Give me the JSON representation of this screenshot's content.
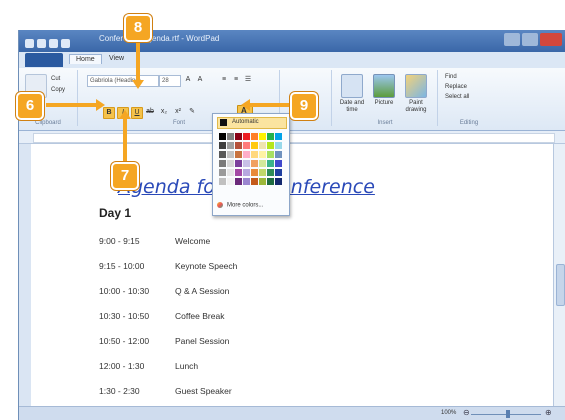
{
  "window": {
    "title": "Conference Agenda.rtf - WordPad"
  },
  "tabs": [
    {
      "label": "Home"
    },
    {
      "label": "View"
    }
  ],
  "ribbon": {
    "clipboard": {
      "cut": "Cut",
      "copy": "Copy",
      "label": "Clipboard"
    },
    "font": {
      "family": "Gabriola (Heading)",
      "size": "28",
      "label": "Font"
    },
    "insert": {
      "date_time": "Date and time",
      "picture": "Picture",
      "paint": "Paint drawing",
      "label": "Insert"
    },
    "editing": {
      "find": "Find",
      "replace": "Replace",
      "select_all": "Select all",
      "label": "Editing"
    }
  },
  "font_color_menu": {
    "automatic": "Automatic",
    "more_colors": "More colors...",
    "colors": [
      [
        "#000000",
        "#7f7f7f",
        "#880015",
        "#ed1c24",
        "#ff7f27",
        "#fff200",
        "#22b14c",
        "#00a2e8"
      ],
      [
        "#3f3f3f",
        "#a0a0a0",
        "#b5523b",
        "#ff7b7b",
        "#ffc90e",
        "#efe4b0",
        "#b5e61d",
        "#99d9ea"
      ],
      [
        "#595959",
        "#c3c3c3",
        "#c8733f",
        "#ffaec9",
        "#ffd87c",
        "#fff3a5",
        "#a8e061",
        "#7092be"
      ],
      [
        "#7a7a7a",
        "#d6d6d6",
        "#7b3f9c",
        "#c8bfe7",
        "#f0a060",
        "#d3e89b",
        "#3ab28a",
        "#3f48cc"
      ],
      [
        "#9a9a9a",
        "#e6e6e6",
        "#a349a4",
        "#b7a8e0",
        "#e88a3a",
        "#c0d86a",
        "#2e8b57",
        "#1f3fa0"
      ],
      [
        "#c0c0c0",
        "#f2f2f2",
        "#6b2a7a",
        "#9b86d0",
        "#c45a1a",
        "#9cb83a",
        "#1e6b40",
        "#14286e"
      ]
    ]
  },
  "document": {
    "heading": "Agenda for the Conference",
    "day": "Day 1",
    "rows": [
      {
        "time": "9:00 - 9:15",
        "event": "Welcome"
      },
      {
        "time": "9:15 - 10:00",
        "event": "Keynote Speech"
      },
      {
        "time": "10:00 - 10:30",
        "event": "Q & A Session"
      },
      {
        "time": "10:30 - 10:50",
        "event": "Coffee Break"
      },
      {
        "time": "10:50 - 12:00",
        "event": "Panel Session"
      },
      {
        "time": "12:00 - 1:30",
        "event": "Lunch"
      },
      {
        "time": "1:30 - 2:30",
        "event": "Guest Speaker"
      }
    ]
  },
  "status": {
    "zoom": "100%"
  },
  "callouts": [
    "6",
    "7",
    "8",
    "9"
  ]
}
